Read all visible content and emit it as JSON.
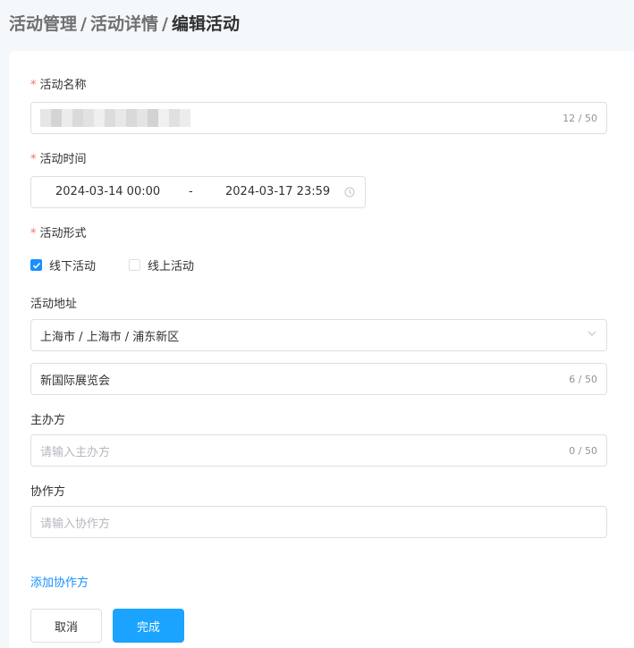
{
  "breadcrumb": {
    "items": [
      "活动管理",
      "活动详情",
      "编辑活动"
    ],
    "separator": "/"
  },
  "form": {
    "name": {
      "label": "活动名称",
      "required_mark": "*",
      "count": "12 / 50",
      "value_redacted": true
    },
    "time": {
      "label": "活动时间",
      "required_mark": "*",
      "start": "2024-03-14 00:00",
      "separator": "-",
      "end": "2024-03-17 23:59",
      "icon": "clock-icon"
    },
    "format": {
      "label": "活动形式",
      "required_mark": "*",
      "options": [
        {
          "label": "线下活动",
          "checked": true
        },
        {
          "label": "线上活动",
          "checked": false
        }
      ]
    },
    "address": {
      "label": "活动地址",
      "region": "上海市 / 上海市 / 浦东新区",
      "detail": "新国际展览会",
      "detail_count": "6 / 50"
    },
    "organizer": {
      "label": "主办方",
      "placeholder": "请输入主办方",
      "count": "0 / 50"
    },
    "co_organizer": {
      "label": "协作方",
      "placeholder": "请输入协作方"
    },
    "add_co_organizer": "添加协作方"
  },
  "actions": {
    "cancel": "取消",
    "submit": "完成"
  },
  "colors": {
    "primary": "#1aa3ff",
    "link": "#1890ff",
    "required": "#f56c6c"
  }
}
